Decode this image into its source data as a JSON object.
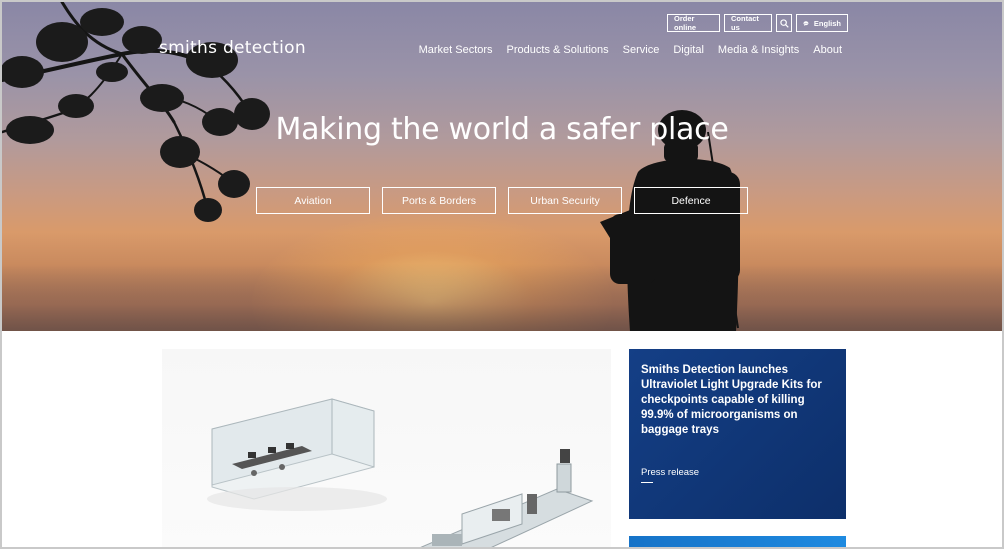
{
  "brand": {
    "logo_text": "smiths detection"
  },
  "utility": {
    "order_online": "Order online",
    "contact_us": "Contact us",
    "search_icon": "search-icon",
    "language": "English",
    "language_icon": "globe-speech-icon"
  },
  "nav": {
    "items": [
      {
        "label": "Market Sectors"
      },
      {
        "label": "Products & Solutions"
      },
      {
        "label": "Service"
      },
      {
        "label": "Digital"
      },
      {
        "label": "Media & Insights"
      },
      {
        "label": "About"
      }
    ]
  },
  "hero": {
    "title": "Making the world a safer place",
    "sectors": [
      {
        "label": "Aviation"
      },
      {
        "label": "Ports & Borders"
      },
      {
        "label": "Urban Security"
      },
      {
        "label": "Defence"
      }
    ]
  },
  "news": {
    "title": "Smiths Detection launches Ultraviolet Light Upgrade Kits for checkpoints capable of killing 99.9% of microorganisms on baggage trays",
    "type": "Press release"
  },
  "colors": {
    "news_card": "#0f3576",
    "accent_blue": "#1e8ae0"
  }
}
